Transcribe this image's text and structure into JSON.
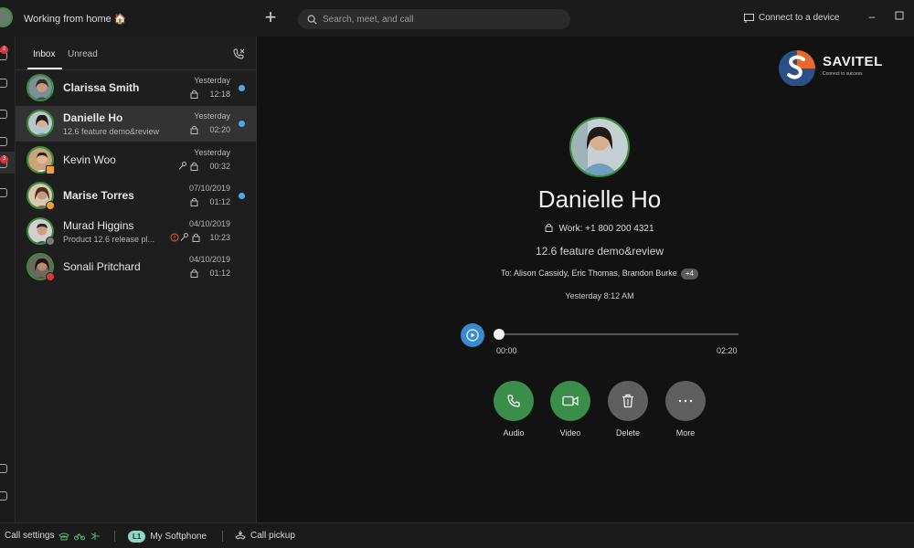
{
  "titlebar": {
    "status": "Working from home 🏠",
    "search_placeholder": "Search, meet, and call",
    "connect_label": "Connect to a device"
  },
  "rail": {
    "badge_messages": "2",
    "badge_voicemail": "3"
  },
  "tabs": [
    {
      "label": "Inbox",
      "active": true
    },
    {
      "label": "Unread",
      "active": false
    }
  ],
  "messages": [
    {
      "name": "Clarissa Smith",
      "preview": "",
      "date": "Yesterday",
      "time": "12:18",
      "unread": true,
      "bold": true
    },
    {
      "name": "Danielle Ho",
      "preview": "12.6 feature demo&review",
      "date": "Yesterday",
      "time": "02:20",
      "unread": true,
      "bold": true,
      "selected": true
    },
    {
      "name": "Kevin Woo",
      "preview": "",
      "date": "Yesterday",
      "time": "00:32",
      "unread": false,
      "bold": false
    },
    {
      "name": "Marise Torres",
      "preview": "",
      "date": "07/10/2019",
      "time": "01:12",
      "unread": true,
      "bold": true
    },
    {
      "name": "Murad Higgins",
      "preview": "Product 12.6 release pl...",
      "date": "04/10/2019",
      "time": "10:23",
      "unread": false,
      "bold": false
    },
    {
      "name": "Sonali Pritchard",
      "preview": "",
      "date": "04/10/2019",
      "time": "01:12",
      "unread": false,
      "bold": false
    }
  ],
  "logo": {
    "name": "SAVITEL",
    "tagline": "Connect to success"
  },
  "detail": {
    "name": "Danielle Ho",
    "work": "Work: +1 800 200 4321",
    "subject": "12.6 feature demo&review",
    "to": "To: Alison Cassidy, Eric Thomas, Brandon Burke",
    "to_more": "+4",
    "when": "Yesterday 8:12 AM",
    "progress": 0,
    "time_start": "00:00",
    "time_end": "02:20",
    "actions": [
      {
        "label": "Audio",
        "color": "#3b8e4a"
      },
      {
        "label": "Video",
        "color": "#3b8e4a"
      },
      {
        "label": "Delete",
        "color": "#5f5f5f"
      },
      {
        "label": "More",
        "color": "#5f5f5f"
      }
    ]
  },
  "bottombar": {
    "call_settings": "Call settings",
    "line_badge": "L1",
    "softphone": "My Softphone",
    "call_pickup": "Call pickup"
  },
  "colors": {
    "accent_green": "#3b8e4a",
    "unread_blue": "#4ea9e8",
    "play_blue": "#3a8ad0"
  }
}
